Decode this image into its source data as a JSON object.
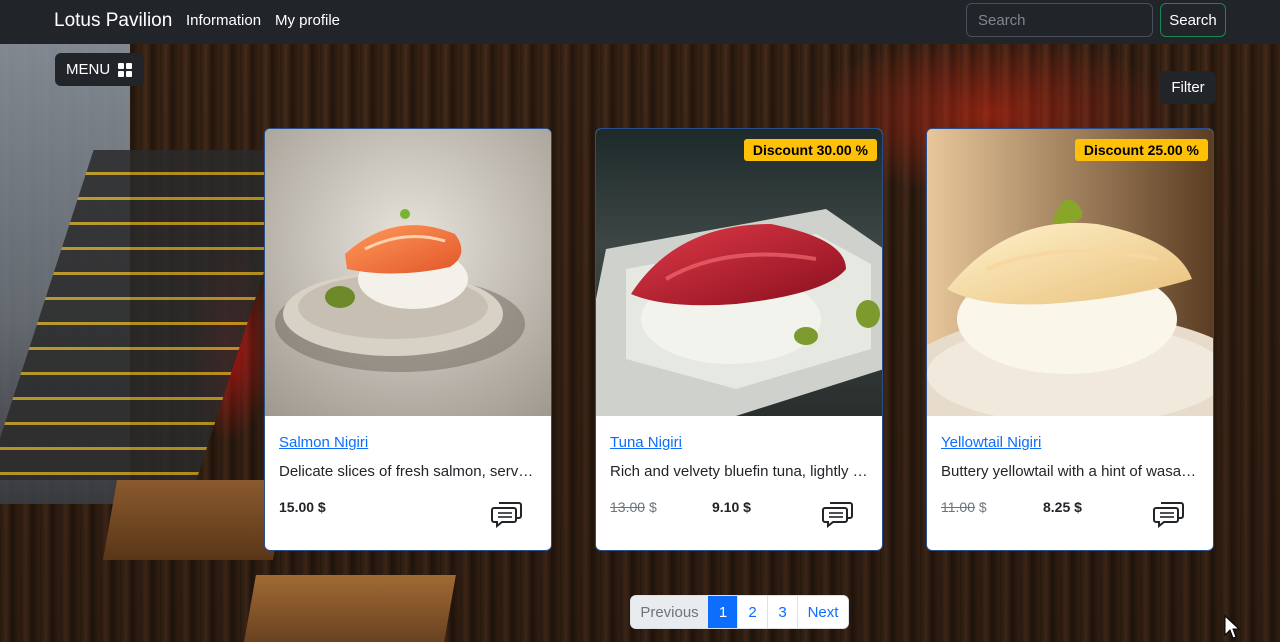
{
  "navbar": {
    "brand": "Lotus Pavilion",
    "links": [
      "Information",
      "My profile"
    ],
    "search_placeholder": "Search",
    "search_button": "Search"
  },
  "menu_button": "MENU",
  "filter_button": "Filter",
  "cards": [
    {
      "title": "Salmon Nigiri",
      "description": "Delicate slices of fresh salmon, served atop seasoned rice",
      "old_price": "",
      "price": "15.00 $",
      "badge": ""
    },
    {
      "title": "Tuna Nigiri",
      "description": "Rich and velvety bluefin tuna, lightly pressed over rice",
      "old_price": "13.00",
      "old_currency": "$",
      "price": "9.10 $",
      "badge": "Discount 30.00 %"
    },
    {
      "title": "Yellowtail Nigiri",
      "description": "Buttery yellowtail with a hint of wasabi on sushi rice",
      "old_price": "11.00",
      "old_currency": "$",
      "price": "8.25 $",
      "badge": "Discount 25.00 %"
    }
  ],
  "pagination": {
    "previous": "Previous",
    "pages": [
      "1",
      "2",
      "3"
    ],
    "active_page": "1",
    "next": "Next"
  },
  "colors": {
    "navbar_bg": "#212529",
    "badge_bg": "#ffc107",
    "link": "#0d6efd",
    "search_border": "#198754"
  }
}
